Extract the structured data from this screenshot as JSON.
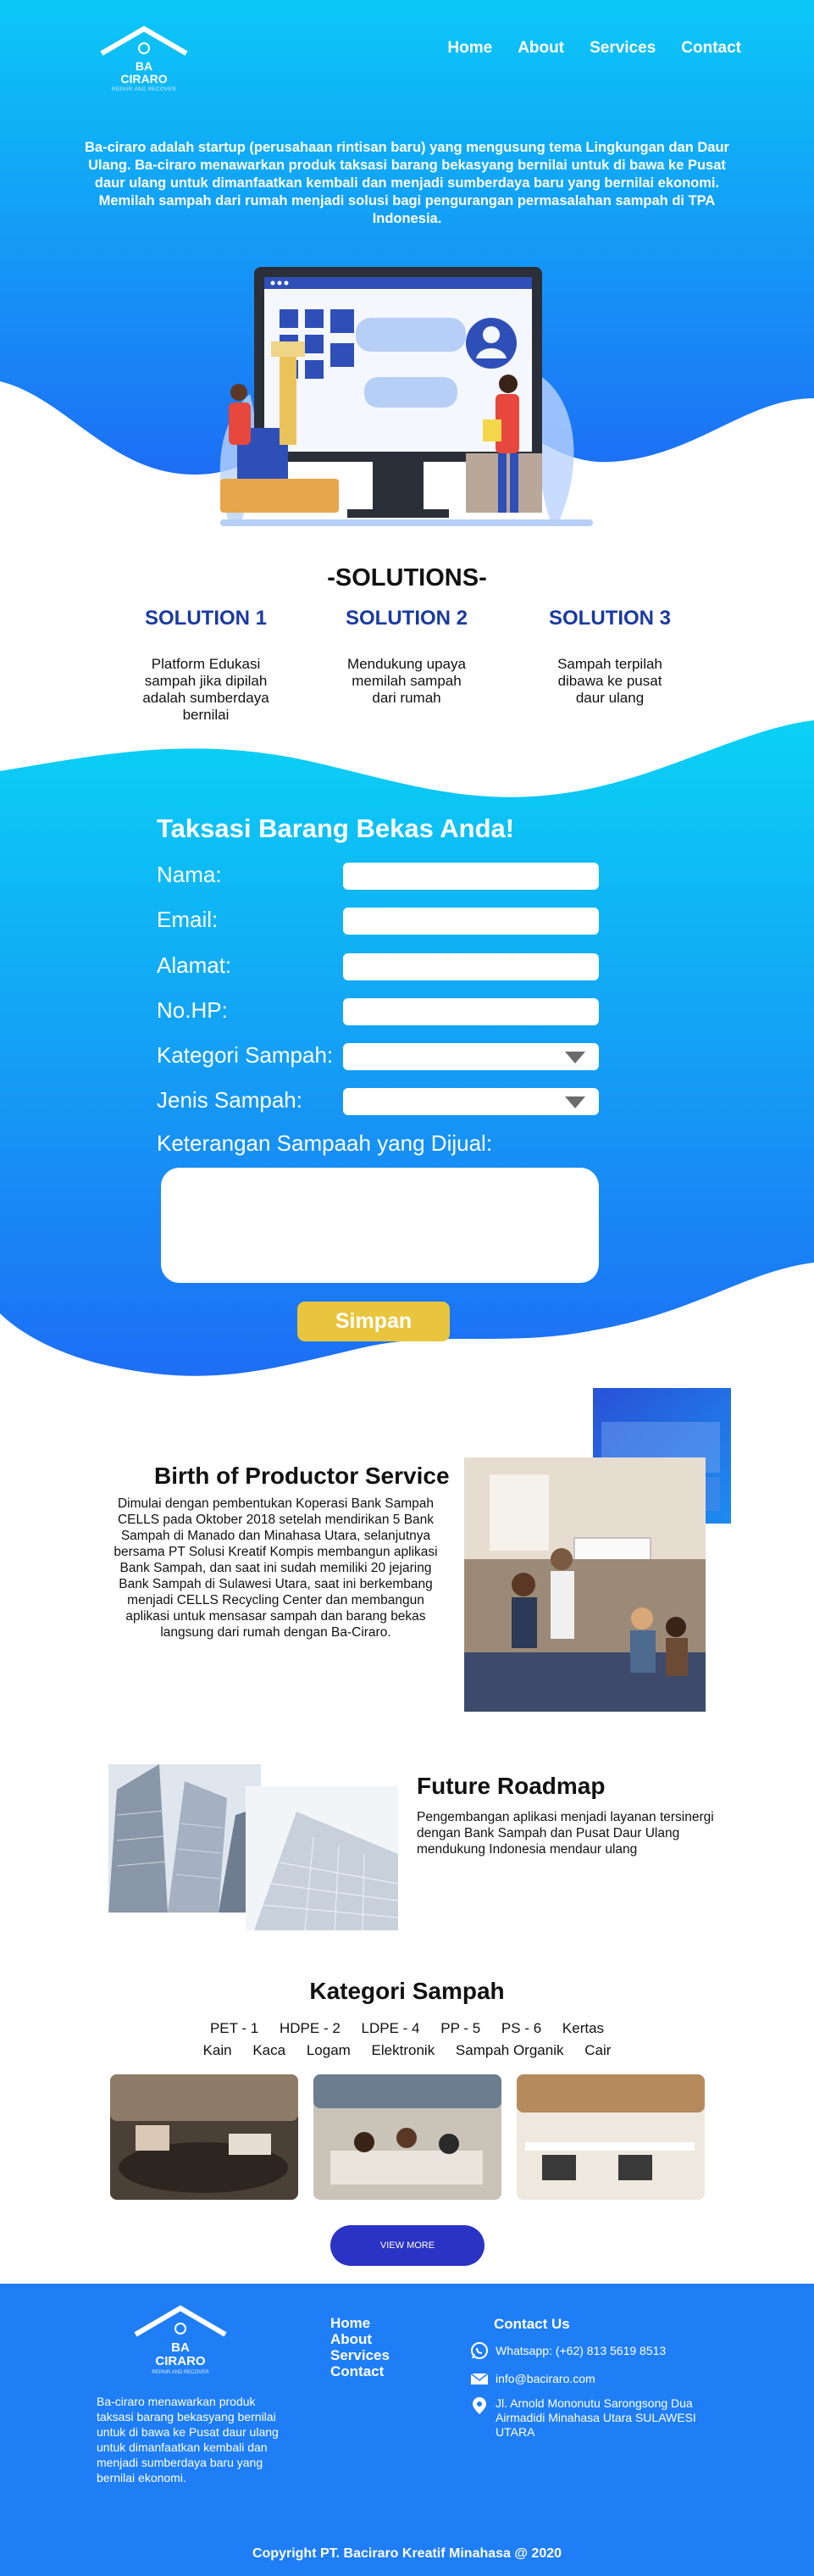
{
  "brand": {
    "line1": "BA",
    "line2": "CIRARO",
    "tagline": "REPAIR AND RECOVER"
  },
  "nav": {
    "items": [
      "Home",
      "About",
      "Services",
      "Contact"
    ]
  },
  "hero": {
    "intro": "Ba-ciraro adalah startup (perusahaan rintisan baru) yang mengusung tema Lingkungan dan Daur Ulang. Ba-ciraro menawarkan produk taksasi barang bekasyang bernilai untuk di bawa ke Pusat daur ulang untuk dimanfaatkan kembali dan menjadi sumberdaya baru yang bernilai ekonomi. Memilah sampah dari rumah menjadi solusi bagi pengurangan permasalahan sampah di TPA Indonesia."
  },
  "solutions": {
    "title": "-SOLUTIONS-",
    "items": [
      {
        "title": "SOLUTION 1",
        "desc": "Platform Edukasi sampah jika dipilah adalah sumberdaya bernilai"
      },
      {
        "title": "SOLUTION 2",
        "desc": "Mendukung upaya memilah sampah dari rumah"
      },
      {
        "title": "SOLUTION 3",
        "desc": "Sampah terpilah dibawa ke pusat daur ulang"
      }
    ]
  },
  "form": {
    "title": "Taksasi Barang Bekas Anda!",
    "labels": {
      "nama": "Nama:",
      "email": "Email:",
      "alamat": "Alamat:",
      "nohp": "No.HP:",
      "kategori": "Kategori Sampah:",
      "jenis": "Jenis Sampah:",
      "keterangan": "Keterangan Sampaah yang Dijual:"
    },
    "submit": "Simpan"
  },
  "birth": {
    "title": "Birth of Productor Service",
    "text": "Dimulai dengan pembentukan Koperasi Bank Sampah CELLS pada Oktober 2018 setelah mendirikan 5 Bank Sampah di Manado dan Minahasa Utara, selanjutnya bersama PT Solusi Kreatif Kompis membangun aplikasi Bank Sampah, dan saat ini sudah memiliki 20 jejaring Bank Sampah di Sulawesi Utara, saat ini berkembang menjadi CELLS Recycling Center dan membangun aplikasi untuk mensasar sampah dan barang bekas langsung dari rumah dengan Ba-Ciraro."
  },
  "roadmap": {
    "title": "Future Roadmap",
    "text": "Pengembangan aplikasi menjadi layanan tersinergi dengan Bank Sampah dan Pusat Daur Ulang mendukung Indonesia mendaur ulang"
  },
  "kategori": {
    "title": "Kategori Sampah",
    "row1": [
      "PET - 1",
      "HDPE - 2",
      "LDPE - 4",
      "PP - 5",
      "PS - 6",
      "Kertas"
    ],
    "row2": [
      "Kain",
      "Kaca",
      "Logam",
      "Elektronik",
      "Sampah Organik",
      "Cair"
    ],
    "view_more": "VIEW MORE"
  },
  "footer": {
    "desc": "Ba-ciraro menawarkan produk taksasi barang bekasyang bernilai untuk di bawa ke Pusat daur ulang untuk dimanfaatkan kembali dan menjadi sumberdaya baru yang bernilai ekonomi.",
    "links": [
      "Home",
      "About",
      "Services",
      "Contact"
    ],
    "contact_title": "Contact Us",
    "whatsapp": "Whatsapp: (+62) 813 5619 8513",
    "email": "info@baciraro.com",
    "address": "Jl. Arnold Mononutu Sarongsong Dua Airmadidi Minahasa Utara SULAWESI UTARA",
    "copyright": "Copyright PT. Baciraro Kreatif Minahasa @ 2020"
  },
  "colors": {
    "primary_blue": "#1f7ef6",
    "cyan": "#0ad2f5",
    "solution_title": "#1a3aa0",
    "save_button": "#e8c53c",
    "view_more_button": "#2b33c4"
  }
}
